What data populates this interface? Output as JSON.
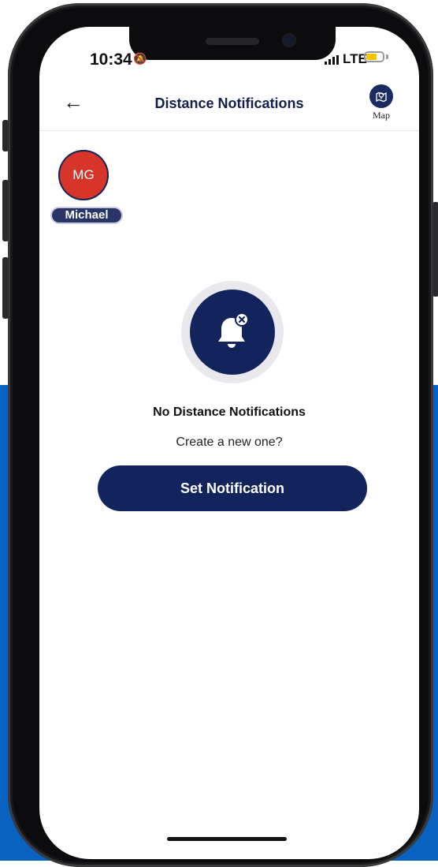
{
  "status": {
    "time": "10:34",
    "network": "LTE"
  },
  "header": {
    "back_label": "←",
    "title": "Distance Notifications",
    "map_label": "Map"
  },
  "member": {
    "initials": "MG",
    "name": "Michael"
  },
  "empty_state": {
    "title": "No Distance Notifications",
    "subtitle": "Create a new one?",
    "button_label": "Set Notification"
  },
  "colors": {
    "primary_navy": "#13245c",
    "avatar_red": "#d8352a",
    "backdrop_blue": "#0a62c0",
    "battery_yellow": "#f5c400"
  },
  "icons": [
    "back-arrow-icon",
    "map-pin-icon",
    "bell-off-icon",
    "silent-bell-icon",
    "signal-icon",
    "battery-icon"
  ]
}
